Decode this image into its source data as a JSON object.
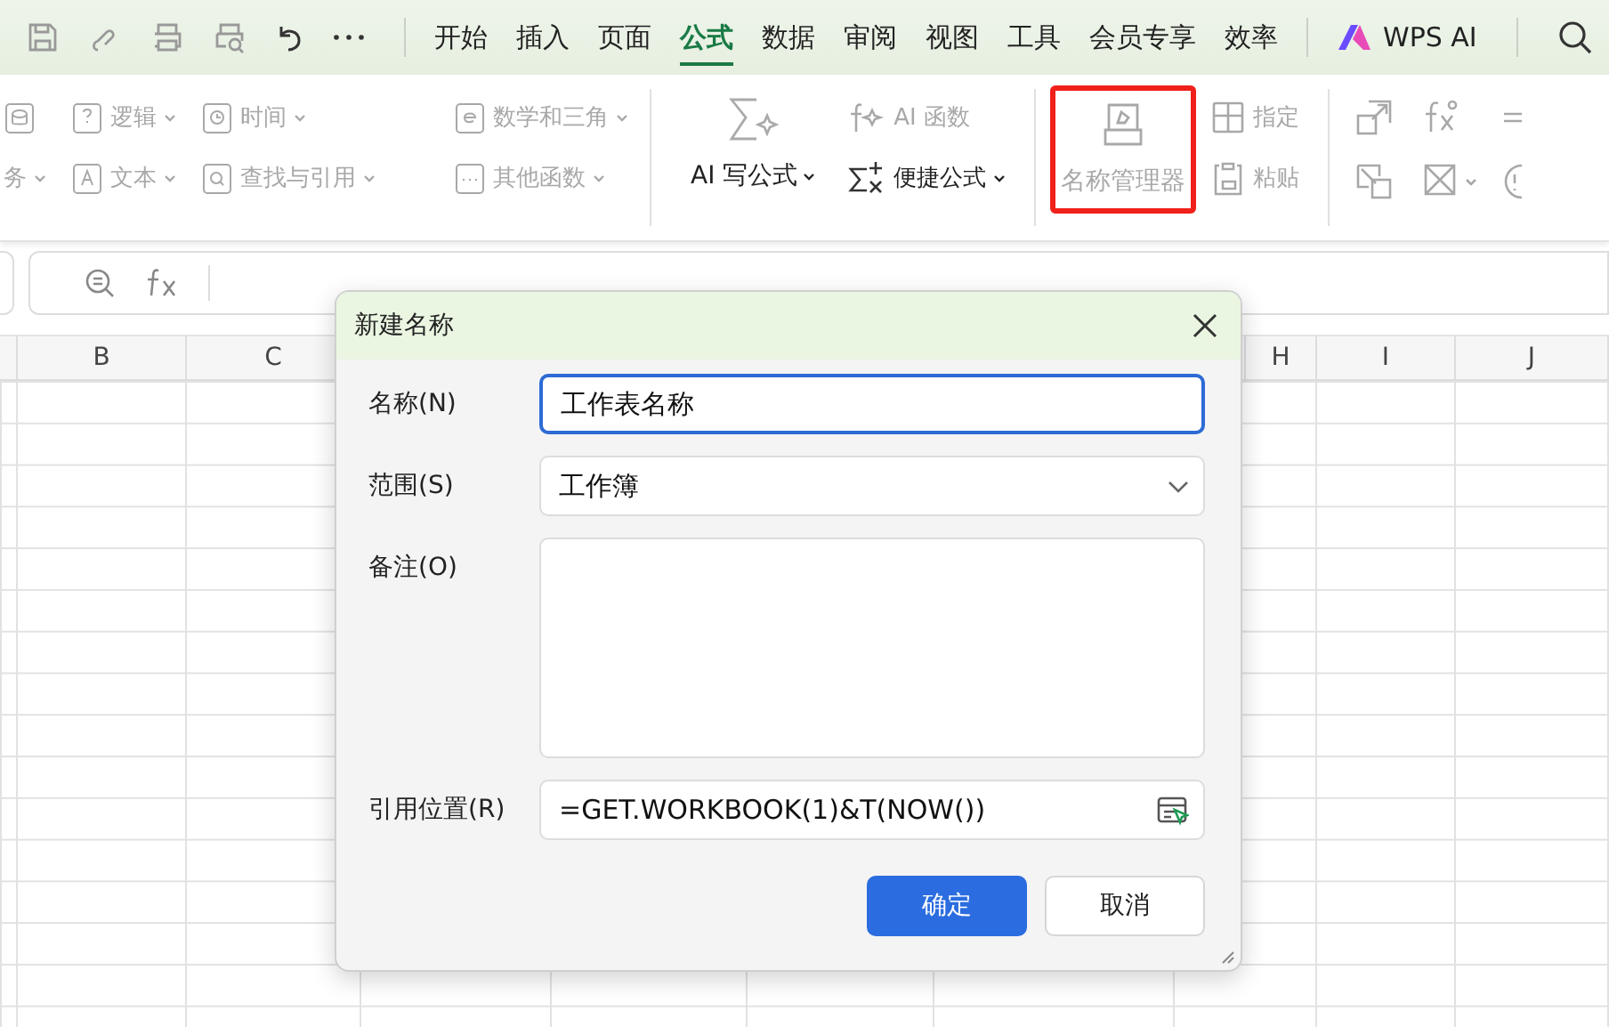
{
  "menu_tabs": [
    {
      "label": "开始",
      "selected": false
    },
    {
      "label": "插入",
      "selected": false
    },
    {
      "label": "页面",
      "selected": false
    },
    {
      "label": "公式",
      "selected": true
    },
    {
      "label": "数据",
      "selected": false
    },
    {
      "label": "审阅",
      "selected": false
    },
    {
      "label": "视图",
      "selected": false
    },
    {
      "label": "工具",
      "selected": false
    },
    {
      "label": "会员专享",
      "selected": false
    },
    {
      "label": "效率",
      "selected": false
    }
  ],
  "ai_button": {
    "label": "WPS AI"
  },
  "ribbon": {
    "function_columns": [
      {
        "items": [
          {
            "kind": "icon"
          },
          {
            "kind": "item",
            "label": "务",
            "disabled": true
          }
        ]
      },
      {
        "items": [
          {
            "kind": "item",
            "label": "逻辑",
            "disabled": true
          },
          {
            "kind": "item",
            "label": "文本",
            "disabled": true
          }
        ]
      },
      {
        "items": [
          {
            "kind": "item",
            "label": "时间",
            "disabled": true
          },
          {
            "kind": "item",
            "label": "查找与引用",
            "disabled": true
          }
        ]
      },
      {
        "items": [
          {
            "kind": "item",
            "label": "数学和三角",
            "disabled": true
          },
          {
            "kind": "item",
            "label": "其他函数",
            "disabled": true
          }
        ]
      }
    ],
    "ai_formula": {
      "label": "AI 写公式"
    },
    "ai_function": {
      "label": "AI 函数",
      "disabled": true
    },
    "quick_formula": {
      "label": "便捷公式",
      "disabled": false
    },
    "name_manager": {
      "label": "名称管理器",
      "disabled": true,
      "highlighted": true
    },
    "assign": {
      "label": "指定",
      "disabled": true
    },
    "paste": {
      "label": "粘贴",
      "disabled": true
    }
  },
  "columns": [
    "B",
    "C",
    "H",
    "I",
    "J"
  ],
  "dialog": {
    "title": "新建名称",
    "fields": [
      {
        "kind": "text",
        "label": "名称(N)",
        "value": "工作表名称",
        "focused": true
      },
      {
        "kind": "select",
        "label": "范围(S)",
        "value": "工作簿",
        "focused": false
      },
      {
        "kind": "textarea",
        "label": "备注(O)",
        "focused": false
      },
      {
        "kind": "reference",
        "label": "引用位置(R)",
        "value": "=GET.WORKBOOK(1)&T(NOW())",
        "focused": false
      }
    ],
    "buttons": [
      {
        "label": "确定",
        "kind": "primary"
      },
      {
        "label": "取消",
        "kind": "secondary"
      }
    ]
  }
}
